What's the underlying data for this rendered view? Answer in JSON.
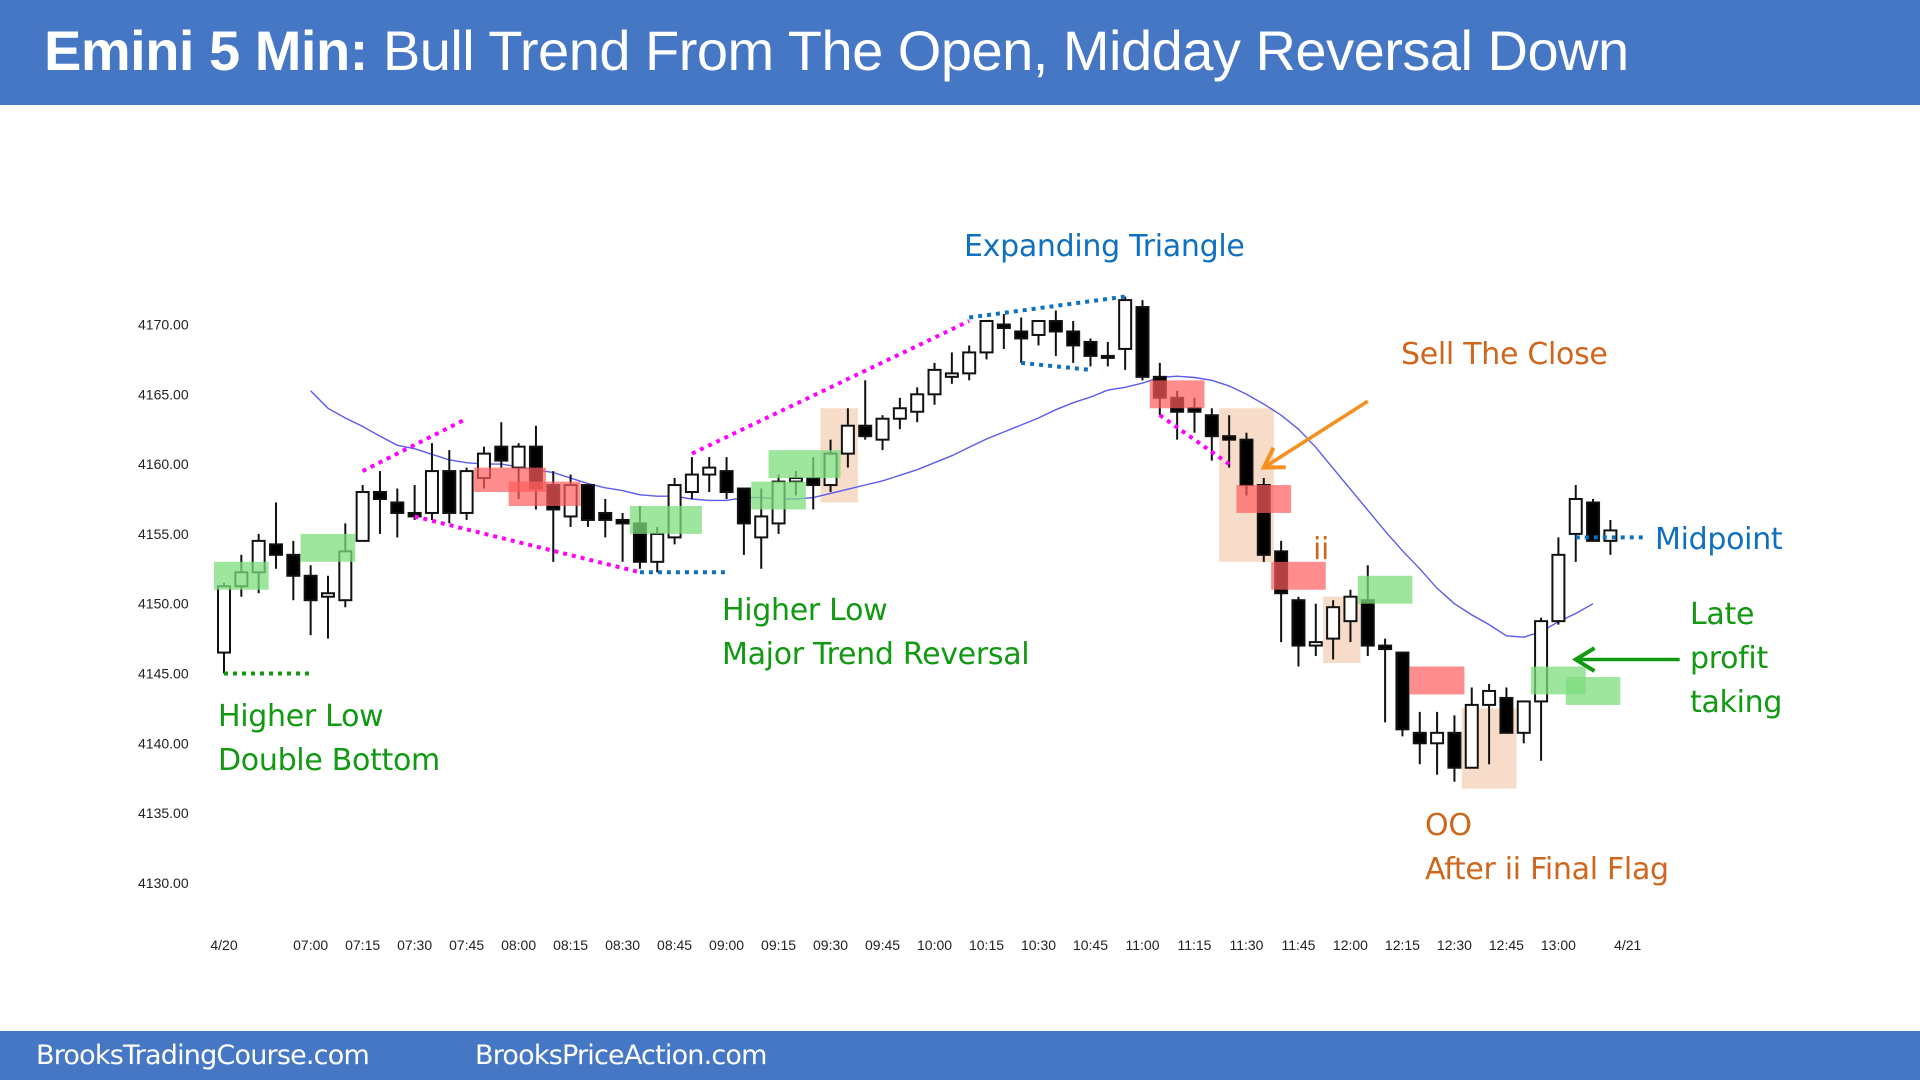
{
  "header": {
    "title_bold": "Emini 5 Min:",
    "title_rest": " Bull Trend From The Open, Midday Reversal Down"
  },
  "footer": {
    "left_link": "BrooksTradingCourse.com",
    "right_link": "BrooksPriceAction.com"
  },
  "colors": {
    "header_bg": "#4677c4",
    "bull_body": "#ffffff",
    "bear_body": "#000000",
    "ema": "#5b5bf0",
    "green_annot": "#119911",
    "blue_annot": "#1070c0",
    "orange_annot": "#d0661c",
    "magenta_line": "#ff00ff",
    "green_box": "#7ddc7d",
    "red_box": "#ff5c5c",
    "tan_box": "#f2cdb2"
  },
  "chart_data": {
    "type": "candlestick",
    "title": "Emini 5 Min: Bull Trend From The Open, Midday Reversal Down",
    "xlabel": "",
    "ylabel": "",
    "ylim": [
      4127,
      4175
    ],
    "yticks": [
      4130,
      4135,
      4140,
      4145,
      4150,
      4155,
      4160,
      4165,
      4170
    ],
    "ytick_labels": [
      "4130.00",
      "4135.00",
      "4140.00",
      "4145.00",
      "4150.00",
      "4155.00",
      "4160.00",
      "4165.00",
      "4170.00"
    ],
    "xtick_labels": [
      {
        "bar": 0,
        "label": "4/20"
      },
      {
        "bar": 5,
        "label": "07:00"
      },
      {
        "bar": 8,
        "label": "07:15"
      },
      {
        "bar": 11,
        "label": "07:30"
      },
      {
        "bar": 14,
        "label": "07:45"
      },
      {
        "bar": 17,
        "label": "08:00"
      },
      {
        "bar": 20,
        "label": "08:15"
      },
      {
        "bar": 23,
        "label": "08:30"
      },
      {
        "bar": 26,
        "label": "08:45"
      },
      {
        "bar": 29,
        "label": "09:00"
      },
      {
        "bar": 32,
        "label": "09:15"
      },
      {
        "bar": 35,
        "label": "09:30"
      },
      {
        "bar": 38,
        "label": "09:45"
      },
      {
        "bar": 41,
        "label": "10:00"
      },
      {
        "bar": 44,
        "label": "10:15"
      },
      {
        "bar": 47,
        "label": "10:30"
      },
      {
        "bar": 50,
        "label": "10:45"
      },
      {
        "bar": 53,
        "label": "11:00"
      },
      {
        "bar": 56,
        "label": "11:15"
      },
      {
        "bar": 59,
        "label": "11:30"
      },
      {
        "bar": 62,
        "label": "11:45"
      },
      {
        "bar": 65,
        "label": "12:00"
      },
      {
        "bar": 68,
        "label": "12:15"
      },
      {
        "bar": 71,
        "label": "12:30"
      },
      {
        "bar": 74,
        "label": "12:45"
      },
      {
        "bar": 77,
        "label": "13:00"
      },
      {
        "bar": 81,
        "label": "4/21"
      }
    ],
    "grid": false,
    "legend": "none",
    "bars": [
      {
        "o": 4146.5,
        "h": 4151.5,
        "l": 4145.0,
        "c": 4151.25
      },
      {
        "o": 4151.25,
        "h": 4153.5,
        "l": 4150.5,
        "c": 4152.25
      },
      {
        "o": 4152.25,
        "h": 4155.0,
        "l": 4150.75,
        "c": 4154.5
      },
      {
        "o": 4154.25,
        "h": 4157.25,
        "l": 4152.5,
        "c": 4153.5
      },
      {
        "o": 4153.5,
        "h": 4154.5,
        "l": 4150.25,
        "c": 4152.0
      },
      {
        "o": 4152.0,
        "h": 4152.75,
        "l": 4147.75,
        "c": 4150.25
      },
      {
        "o": 4150.5,
        "h": 4152.0,
        "l": 4147.5,
        "c": 4150.75
      },
      {
        "o": 4150.25,
        "h": 4155.75,
        "l": 4149.75,
        "c": 4153.75
      },
      {
        "o": 4154.5,
        "h": 4158.5,
        "l": 4154.5,
        "c": 4158.0
      },
      {
        "o": 4158.0,
        "h": 4159.5,
        "l": 4155.0,
        "c": 4157.5
      },
      {
        "o": 4157.25,
        "h": 4158.25,
        "l": 4154.75,
        "c": 4156.5
      },
      {
        "o": 4156.5,
        "h": 4158.5,
        "l": 4156.0,
        "c": 4156.25
      },
      {
        "o": 4156.5,
        "h": 4161.5,
        "l": 4156.0,
        "c": 4159.5
      },
      {
        "o": 4159.5,
        "h": 4161.0,
        "l": 4155.75,
        "c": 4156.5
      },
      {
        "o": 4156.5,
        "h": 4159.75,
        "l": 4156.0,
        "c": 4159.5
      },
      {
        "o": 4159.0,
        "h": 4161.25,
        "l": 4158.25,
        "c": 4160.75
      },
      {
        "o": 4161.25,
        "h": 4163.0,
        "l": 4159.75,
        "c": 4160.25
      },
      {
        "o": 4159.75,
        "h": 4161.5,
        "l": 4157.5,
        "c": 4161.25
      },
      {
        "o": 4161.25,
        "h": 4162.75,
        "l": 4156.75,
        "c": 4158.25
      },
      {
        "o": 4158.5,
        "h": 4159.5,
        "l": 4153.0,
        "c": 4156.75
      },
      {
        "o": 4156.25,
        "h": 4159.25,
        "l": 4155.5,
        "c": 4158.5
      },
      {
        "o": 4158.5,
        "h": 4158.5,
        "l": 4155.5,
        "c": 4156.0
      },
      {
        "o": 4156.5,
        "h": 4157.5,
        "l": 4154.75,
        "c": 4156.0
      },
      {
        "o": 4156.0,
        "h": 4156.5,
        "l": 4153.0,
        "c": 4155.75
      },
      {
        "o": 4155.75,
        "h": 4157.0,
        "l": 4152.5,
        "c": 4153.0
      },
      {
        "o": 4153.0,
        "h": 4155.5,
        "l": 4152.25,
        "c": 4155.0
      },
      {
        "o": 4154.75,
        "h": 4159.0,
        "l": 4154.25,
        "c": 4158.5
      },
      {
        "o": 4158.0,
        "h": 4160.5,
        "l": 4157.5,
        "c": 4159.25
      },
      {
        "o": 4159.25,
        "h": 4160.5,
        "l": 4158.0,
        "c": 4159.75
      },
      {
        "o": 4159.5,
        "h": 4160.5,
        "l": 4157.5,
        "c": 4158.0
      },
      {
        "o": 4158.25,
        "h": 4158.25,
        "l": 4153.5,
        "c": 4155.75
      },
      {
        "o": 4154.75,
        "h": 4158.25,
        "l": 4152.5,
        "c": 4156.25
      },
      {
        "o": 4155.75,
        "h": 4159.25,
        "l": 4155.0,
        "c": 4158.75
      },
      {
        "o": 4158.75,
        "h": 4159.5,
        "l": 4157.75,
        "c": 4159.0
      },
      {
        "o": 4159.0,
        "h": 4160.5,
        "l": 4156.75,
        "c": 4158.5
      },
      {
        "o": 4158.5,
        "h": 4161.75,
        "l": 4158.0,
        "c": 4160.75
      },
      {
        "o": 4160.75,
        "h": 4164.0,
        "l": 4159.75,
        "c": 4162.75
      },
      {
        "o": 4162.75,
        "h": 4166.0,
        "l": 4161.75,
        "c": 4162.0
      },
      {
        "o": 4161.75,
        "h": 4163.5,
        "l": 4161.0,
        "c": 4163.25
      },
      {
        "o": 4163.25,
        "h": 4164.75,
        "l": 4162.5,
        "c": 4164.0
      },
      {
        "o": 4163.75,
        "h": 4165.5,
        "l": 4163.0,
        "c": 4165.0
      },
      {
        "o": 4165.0,
        "h": 4167.25,
        "l": 4164.25,
        "c": 4166.75
      },
      {
        "o": 4166.25,
        "h": 4168.0,
        "l": 4165.75,
        "c": 4166.5
      },
      {
        "o": 4166.5,
        "h": 4168.5,
        "l": 4166.0,
        "c": 4168.0
      },
      {
        "o": 4168.0,
        "h": 4170.25,
        "l": 4167.5,
        "c": 4170.25
      },
      {
        "o": 4170.0,
        "h": 4170.75,
        "l": 4168.25,
        "c": 4169.75
      },
      {
        "o": 4169.5,
        "h": 4170.5,
        "l": 4167.25,
        "c": 4169.0
      },
      {
        "o": 4169.25,
        "h": 4170.25,
        "l": 4168.5,
        "c": 4170.25
      },
      {
        "o": 4170.25,
        "h": 4171.0,
        "l": 4167.75,
        "c": 4169.5
      },
      {
        "o": 4169.5,
        "h": 4170.25,
        "l": 4167.25,
        "c": 4168.5
      },
      {
        "o": 4168.75,
        "h": 4169.0,
        "l": 4167.0,
        "c": 4167.75
      },
      {
        "o": 4167.75,
        "h": 4168.75,
        "l": 4167.0,
        "c": 4167.75
      },
      {
        "o": 4168.25,
        "h": 4172.0,
        "l": 4166.75,
        "c": 4171.75
      },
      {
        "o": 4171.25,
        "h": 4171.75,
        "l": 4166.0,
        "c": 4166.25
      },
      {
        "o": 4166.25,
        "h": 4167.25,
        "l": 4163.5,
        "c": 4164.75
      },
      {
        "o": 4164.75,
        "h": 4165.25,
        "l": 4161.75,
        "c": 4163.75
      },
      {
        "o": 4164.0,
        "h": 4164.75,
        "l": 4162.25,
        "c": 4163.75
      },
      {
        "o": 4163.5,
        "h": 4164.0,
        "l": 4160.25,
        "c": 4162.0
      },
      {
        "o": 4162.0,
        "h": 4163.5,
        "l": 4159.75,
        "c": 4161.75
      },
      {
        "o": 4161.75,
        "h": 4162.25,
        "l": 4157.75,
        "c": 4158.5
      },
      {
        "o": 4158.5,
        "h": 4159.0,
        "l": 4153.0,
        "c": 4153.5
      },
      {
        "o": 4153.75,
        "h": 4154.5,
        "l": 4147.25,
        "c": 4150.75
      },
      {
        "o": 4150.25,
        "h": 4150.5,
        "l": 4145.5,
        "c": 4147.0
      },
      {
        "o": 4147.0,
        "h": 4150.0,
        "l": 4146.25,
        "c": 4147.25
      },
      {
        "o": 4147.5,
        "h": 4150.25,
        "l": 4146.0,
        "c": 4149.75
      },
      {
        "o": 4148.75,
        "h": 4151.0,
        "l": 4147.25,
        "c": 4150.5
      },
      {
        "o": 4150.25,
        "h": 4152.75,
        "l": 4146.25,
        "c": 4147.0
      },
      {
        "o": 4147.0,
        "h": 4147.5,
        "l": 4141.5,
        "c": 4146.75
      },
      {
        "o": 4146.5,
        "h": 4146.5,
        "l": 4140.5,
        "c": 4141.0
      },
      {
        "o": 4140.75,
        "h": 4142.25,
        "l": 4138.5,
        "c": 4140.0
      },
      {
        "o": 4140.0,
        "h": 4142.25,
        "l": 4137.75,
        "c": 4140.75
      },
      {
        "o": 4140.75,
        "h": 4142.0,
        "l": 4137.25,
        "c": 4138.25
      },
      {
        "o": 4138.25,
        "h": 4144.0,
        "l": 4138.25,
        "c": 4142.75
      },
      {
        "o": 4142.75,
        "h": 4144.25,
        "l": 4138.5,
        "c": 4143.75
      },
      {
        "o": 4143.25,
        "h": 4144.0,
        "l": 4140.75,
        "c": 4140.75
      },
      {
        "o": 4140.75,
        "h": 4143.0,
        "l": 4140.0,
        "c": 4143.0
      },
      {
        "o": 4143.0,
        "h": 4149.0,
        "l": 4138.75,
        "c": 4148.75
      },
      {
        "o": 4148.75,
        "h": 4154.75,
        "l": 4148.5,
        "c": 4153.5
      },
      {
        "o": 4155.0,
        "h": 4158.5,
        "l": 4153.0,
        "c": 4157.5
      },
      {
        "o": 4157.25,
        "h": 4157.5,
        "l": 4154.5,
        "c": 4154.5
      },
      {
        "o": 4154.5,
        "h": 4156.0,
        "l": 4153.5,
        "c": 4155.25
      }
    ],
    "bar_start_time": "06:35",
    "bar_interval_min": 5,
    "ema": {
      "name": "EMA",
      "start_bar": 5,
      "values": [
        4165.25,
        4164.0,
        4163.3,
        4162.7,
        4162.0,
        4161.35,
        4161.1,
        4160.7,
        4160.3,
        4160.1,
        4160.0,
        4160.0,
        4159.8,
        4159.6,
        4159.4,
        4159.0,
        4158.6,
        4158.3,
        4158.1,
        4157.8,
        4157.7,
        4157.7,
        4157.5,
        4157.4,
        4157.4,
        4157.6,
        4157.6,
        4157.5,
        4157.5,
        4157.6,
        4157.9,
        4158.2,
        4158.5,
        4158.8,
        4159.2,
        4159.6,
        4160.1,
        4160.6,
        4161.2,
        4161.8,
        4162.3,
        4162.8,
        4163.3,
        4163.9,
        4164.4,
        4164.8,
        4165.3,
        4165.5,
        4165.8,
        4166.2,
        4166.3,
        4166.2,
        4166.0,
        4165.6,
        4165.0,
        4164.3,
        4163.5,
        4162.5,
        4161.2,
        4159.7,
        4158.2,
        4156.7,
        4155.2,
        4153.8,
        4152.5,
        4151.1,
        4150.0,
        4149.2,
        4148.5,
        4147.7,
        4147.6,
        4148.0,
        4148.7,
        4149.3,
        4150.0
      ]
    },
    "shaded_zones": [
      {
        "kind": "green",
        "bar_from": 0,
        "bar_to": 2,
        "price_lo": 4151.0,
        "price_hi": 4153.0
      },
      {
        "kind": "green",
        "bar_from": 5,
        "bar_to": 7,
        "price_lo": 4153.0,
        "price_hi": 4155.0
      },
      {
        "kind": "red",
        "bar_from": 15,
        "bar_to": 18,
        "price_lo": 4158.0,
        "price_hi": 4159.75
      },
      {
        "kind": "red",
        "bar_from": 17,
        "bar_to": 20,
        "price_lo": 4157.0,
        "price_hi": 4158.75
      },
      {
        "kind": "green",
        "bar_from": 24,
        "bar_to": 27,
        "price_lo": 4155.0,
        "price_hi": 4157.0
      },
      {
        "kind": "green",
        "bar_from": 31,
        "bar_to": 33,
        "price_lo": 4156.75,
        "price_hi": 4158.75
      },
      {
        "kind": "green",
        "bar_from": 32,
        "bar_to": 35,
        "price_lo": 4159.0,
        "price_hi": 4161.0
      },
      {
        "kind": "tan",
        "bar_from": 35,
        "bar_to": 36,
        "price_lo": 4157.25,
        "price_hi": 4164.0
      },
      {
        "kind": "red",
        "bar_from": 54,
        "bar_to": 56,
        "price_lo": 4164.0,
        "price_hi": 4166.0
      },
      {
        "kind": "tan",
        "bar_from": 58,
        "bar_to": 60,
        "price_lo": 4153.0,
        "price_hi": 4164.0
      },
      {
        "kind": "red",
        "bar_from": 59,
        "bar_to": 61,
        "price_lo": 4156.5,
        "price_hi": 4158.5
      },
      {
        "kind": "red",
        "bar_from": 61,
        "bar_to": 63,
        "price_lo": 4151.0,
        "price_hi": 4153.0
      },
      {
        "kind": "tan",
        "bar_from": 64,
        "bar_to": 65,
        "price_lo": 4145.75,
        "price_hi": 4150.5
      },
      {
        "kind": "green",
        "bar_from": 66,
        "bar_to": 68,
        "price_lo": 4150.0,
        "price_hi": 4152.0
      },
      {
        "kind": "red",
        "bar_from": 69,
        "bar_to": 71,
        "price_lo": 4143.5,
        "price_hi": 4145.5
      },
      {
        "kind": "tan",
        "bar_from": 72,
        "bar_to": 74,
        "price_lo": 4136.75,
        "price_hi": 4142.5
      },
      {
        "kind": "green",
        "bar_from": 76,
        "bar_to": 78,
        "price_lo": 4143.5,
        "price_hi": 4145.5
      },
      {
        "kind": "green",
        "bar_from": 78,
        "bar_to": 80,
        "price_lo": 4142.75,
        "price_hi": 4144.75
      }
    ],
    "trendlines": [
      {
        "kind": "green-dotted",
        "from": {
          "bar": 0,
          "price": 4145.0
        },
        "to": {
          "bar": 5,
          "price": 4145.0
        }
      },
      {
        "kind": "magenta-dotted",
        "from": {
          "bar": 8,
          "price": 4159.5
        },
        "to": {
          "bar": 14,
          "price": 4163.25
        }
      },
      {
        "kind": "magenta-dotted",
        "from": {
          "bar": 11,
          "price": 4156.25
        },
        "to": {
          "bar": 24,
          "price": 4152.25
        }
      },
      {
        "kind": "blue-dotted",
        "from": {
          "bar": 24,
          "price": 4152.25
        },
        "to": {
          "bar": 29,
          "price": 4152.25
        }
      },
      {
        "kind": "magenta-dotted",
        "from": {
          "bar": 27,
          "price": 4160.75
        },
        "to": {
          "bar": 43,
          "price": 4170.25
        }
      },
      {
        "kind": "blue-dotted",
        "from": {
          "bar": 43,
          "price": 4170.5
        },
        "to": {
          "bar": 52,
          "price": 4172.0
        }
      },
      {
        "kind": "blue-dotted",
        "from": {
          "bar": 46,
          "price": 4167.25
        },
        "to": {
          "bar": 50,
          "price": 4166.75
        }
      },
      {
        "kind": "magenta-dotted",
        "from": {
          "bar": 54,
          "price": 4163.5
        },
        "to": {
          "bar": 58,
          "price": 4160.0
        }
      },
      {
        "kind": "blue-dotted",
        "from": {
          "bar": 78,
          "price": 4154.75
        },
        "to": {
          "bar": 82,
          "price": 4154.75
        }
      }
    ],
    "arrows": [
      {
        "color": "orange",
        "from": {
          "bar": 66,
          "price": 4164.5
        },
        "to": {
          "bar": 60,
          "price": 4159.75
        }
      },
      {
        "color": "green",
        "from": {
          "bar": 84,
          "price": 4146.0
        },
        "to": {
          "bar": 78,
          "price": 4146.0
        }
      }
    ],
    "annotations": [
      {
        "id": "higher-low-double-bottom",
        "lines": [
          "Higher Low",
          "Double Bottom"
        ],
        "color": "green"
      },
      {
        "id": "higher-low-mtr",
        "lines": [
          "Higher Low",
          "Major Trend Reversal"
        ],
        "color": "green"
      },
      {
        "id": "expanding-triangle",
        "lines": [
          "Expanding Triangle"
        ],
        "color": "blue"
      },
      {
        "id": "sell-the-close",
        "lines": [
          "Sell The Close"
        ],
        "color": "orange"
      },
      {
        "id": "ii",
        "lines": [
          "ii"
        ],
        "color": "orange"
      },
      {
        "id": "oo-final-flag",
        "lines": [
          "OO",
          "After ii Final Flag"
        ],
        "color": "orange"
      },
      {
        "id": "midpoint",
        "lines": [
          "Midpoint"
        ],
        "color": "blue"
      },
      {
        "id": "late-profit-taking",
        "lines": [
          "Late",
          "profit",
          "taking"
        ],
        "color": "green"
      }
    ]
  }
}
